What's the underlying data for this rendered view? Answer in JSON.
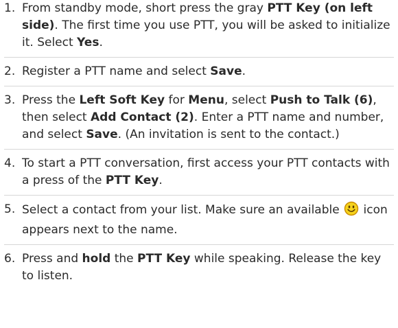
{
  "steps": [
    {
      "number": "1.",
      "parts": [
        "From standby mode, short press the gray ",
        "PTT Key (on left side)",
        ". The first time you use PTT, you will be asked to initialize it. Select ",
        "Yes",
        "."
      ]
    },
    {
      "number": "2.",
      "parts": [
        "Register a PTT name and select ",
        "Save",
        "."
      ]
    },
    {
      "number": "3.",
      "parts": [
        "Press the ",
        "Left Soft Key",
        " for ",
        "Menu",
        ", select ",
        "Push to Talk (6)",
        ", then select ",
        "Add Contact (2)",
        ". Enter a PTT name and number, and select ",
        "Save",
        ". (An invitation is sent to the contact.)"
      ]
    },
    {
      "number": "4.",
      "parts": [
        "To start a PTT conversation, first access your PTT contacts with a press of the ",
        "PTT Key",
        "."
      ]
    },
    {
      "number": "5.",
      "parts": [
        "Select a contact from your list. Make sure an available ",
        "icon appears next to the name."
      ],
      "icon": "smiley-available-icon"
    },
    {
      "number": "6.",
      "parts": [
        "Press and ",
        "hold",
        " the ",
        "PTT Key",
        " while speaking. Release the key to listen."
      ]
    }
  ],
  "colors": {
    "text": "#2a2a2a",
    "divider": "#d6d6d6",
    "icon_fill": "#f5d21c",
    "icon_stroke": "#c98a00"
  }
}
